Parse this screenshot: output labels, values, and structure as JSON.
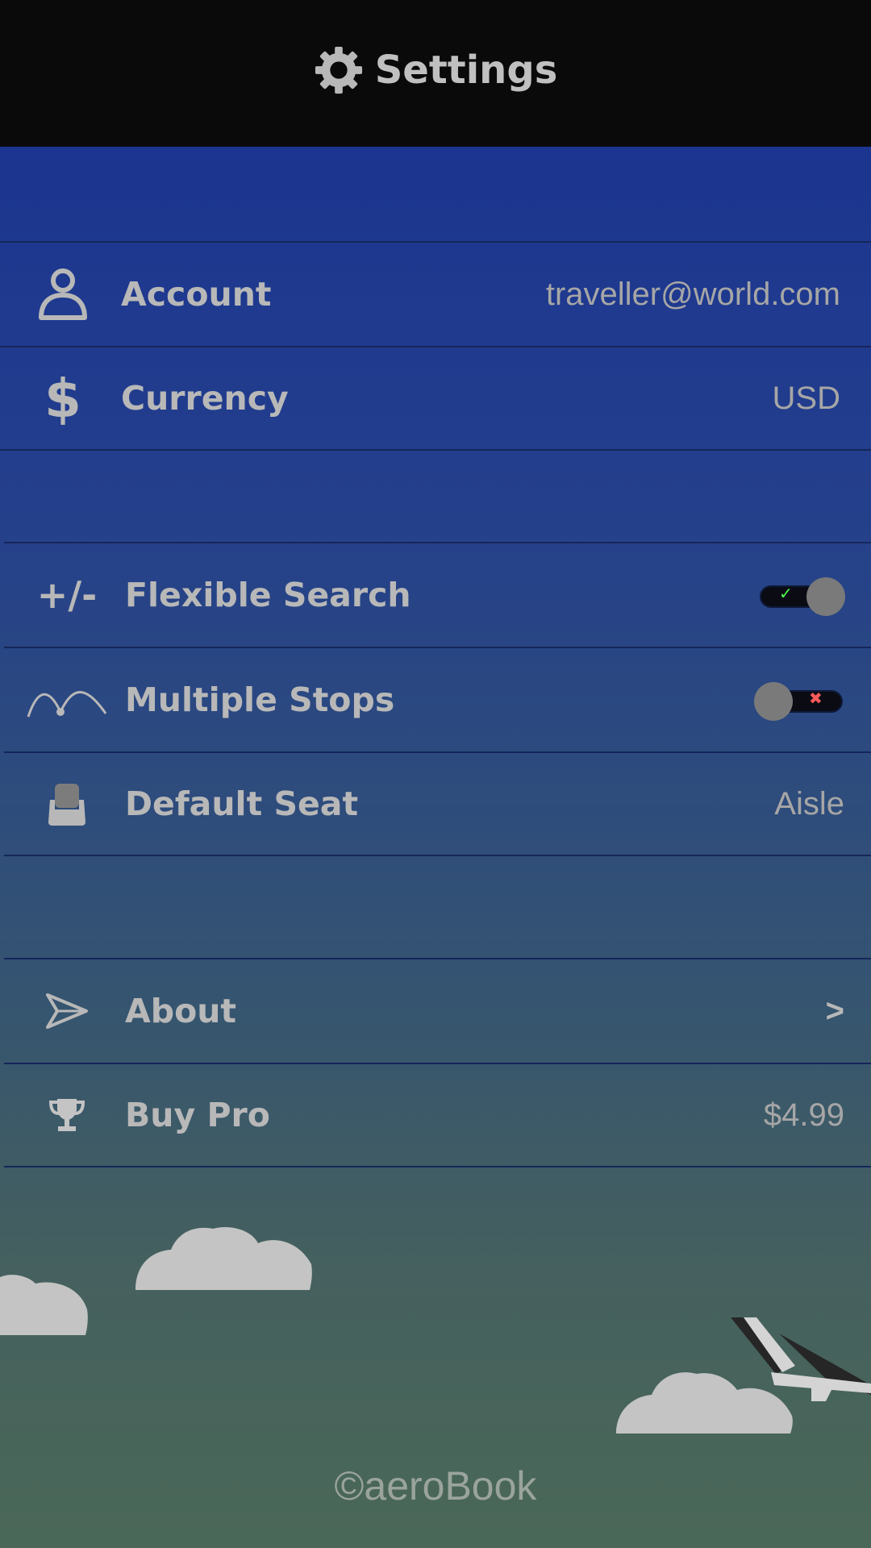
{
  "header": {
    "title": "Settings",
    "icon": "gear-icon"
  },
  "account_section": {
    "items": [
      {
        "label": "Account",
        "value": "traveller@world.com",
        "icon": "person-icon"
      },
      {
        "label": "Currency",
        "value": "USD",
        "icon": "dollar-icon"
      }
    ]
  },
  "search_section": {
    "items": [
      {
        "label": "Flexible Search",
        "icon": "plus-minus-icon",
        "toggle_on": true,
        "mark": "✓"
      },
      {
        "label": "Multiple Stops",
        "icon": "route-stops-icon",
        "toggle_on": false,
        "mark": "✖"
      },
      {
        "label": "Default Seat",
        "value": "Aisle",
        "icon": "seat-icon"
      }
    ]
  },
  "info_section": {
    "items": [
      {
        "label": "About",
        "value": ">",
        "icon": "paper-plane-icon"
      },
      {
        "label": "Buy Pro",
        "value": "$4.99",
        "icon": "trophy-icon"
      }
    ]
  },
  "footer": {
    "copyright": "©aeroBook"
  },
  "colors": {
    "header_bg": "#0a0a0a",
    "gradient_top": "#1b3590",
    "gradient_bottom": "#4a6858",
    "toggle_on_mark": "#4cff4c",
    "toggle_off_mark": "#ff5a5a"
  }
}
